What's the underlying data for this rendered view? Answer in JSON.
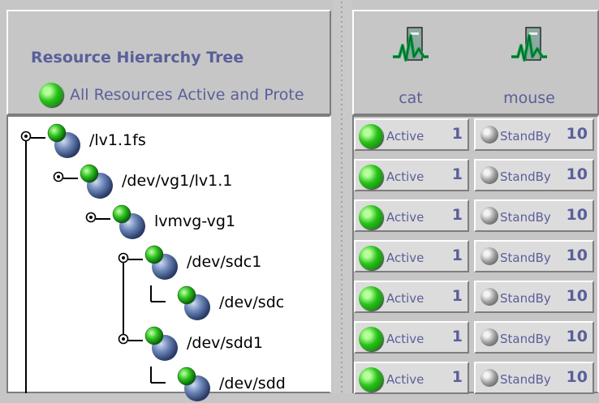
{
  "left_header": {
    "title": "Resource Hierarchy Tree",
    "status_text": "All Resources Active and Prote"
  },
  "servers": [
    {
      "name": "cat"
    },
    {
      "name": "mouse"
    }
  ],
  "tree": [
    {
      "label": "/lv1.1fs",
      "depth": 0,
      "handle": true
    },
    {
      "label": "/dev/vg1/lv1.1",
      "depth": 1,
      "handle": true
    },
    {
      "label": "lvmvg-vg1",
      "depth": 2,
      "handle": true
    },
    {
      "label": "/dev/sdc1",
      "depth": 3,
      "handle": true
    },
    {
      "label": "/dev/sdc",
      "depth": 4,
      "handle": false
    },
    {
      "label": "/dev/sdd1",
      "depth": 3,
      "handle": true
    },
    {
      "label": "/dev/sdd",
      "depth": 4,
      "handle": false
    }
  ],
  "states": [
    {
      "left": {
        "text": "Active",
        "priority": "1"
      },
      "right": {
        "text": "StandBy",
        "priority": "10"
      }
    },
    {
      "left": {
        "text": "Active",
        "priority": "1"
      },
      "right": {
        "text": "StandBy",
        "priority": "10"
      }
    },
    {
      "left": {
        "text": "Active",
        "priority": "1"
      },
      "right": {
        "text": "StandBy",
        "priority": "10"
      }
    },
    {
      "left": {
        "text": "Active",
        "priority": "1"
      },
      "right": {
        "text": "StandBy",
        "priority": "10"
      }
    },
    {
      "left": {
        "text": "Active",
        "priority": "1"
      },
      "right": {
        "text": "StandBy",
        "priority": "10"
      }
    },
    {
      "left": {
        "text": "Active",
        "priority": "1"
      },
      "right": {
        "text": "StandBy",
        "priority": "10"
      }
    },
    {
      "left": {
        "text": "Active",
        "priority": "1"
      },
      "right": {
        "text": "StandBy",
        "priority": "10"
      }
    }
  ],
  "colors": {
    "accent_text": "#5a5f9a",
    "active_green": "#29c21a",
    "standby_gray": "#9c9c9c",
    "panel_bg": "#c6c6c6"
  }
}
